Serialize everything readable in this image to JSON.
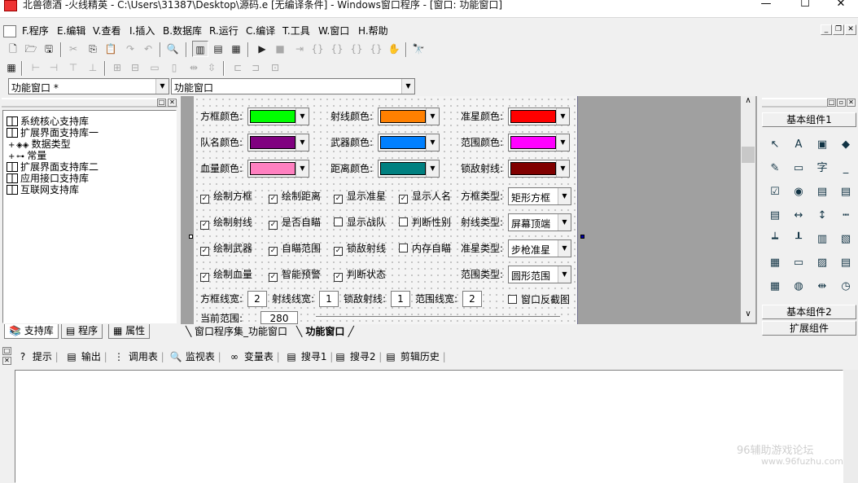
{
  "window": {
    "title": "北兽德酒 -火线精英 - C:\\Users\\31387\\Desktop\\源码.e [无编译条件] - Windows窗口程序 - [窗口: 功能窗口]",
    "min": "—",
    "max": "☐",
    "close": "✕"
  },
  "menu": [
    "F.程序",
    "E.编辑",
    "V.查看",
    "I.插入",
    "B.数据库",
    "R.运行",
    "C.编译",
    "T.工具",
    "W.窗口",
    "H.帮助"
  ],
  "mdi_buttons": [
    "_",
    "❐",
    "✕"
  ],
  "combos": {
    "left": "功能窗口 *",
    "right": "功能窗口"
  },
  "left_panel": {
    "tree": [
      {
        "label": "系统核心支持库",
        "level": 0
      },
      {
        "label": "扩展界面支持库一",
        "level": 0
      },
      {
        "label": "数据类型",
        "level": 1,
        "expander": "+"
      },
      {
        "label": "常量",
        "level": 1,
        "expander": "+"
      },
      {
        "label": "扩展界面支持库二",
        "level": 0
      },
      {
        "label": "应用接口支持库",
        "level": 0
      },
      {
        "label": "互联网支持库",
        "level": 0
      }
    ],
    "tabs": [
      "支持库",
      "程序",
      "属性"
    ]
  },
  "form": {
    "colors": [
      {
        "label": "方框颜色:",
        "color": "#00ff00"
      },
      {
        "label": "射线颜色:",
        "color": "#ff8000"
      },
      {
        "label": "准星颜色:",
        "color": "#ff0000"
      },
      {
        "label": "队名颜色:",
        "color": "#800080"
      },
      {
        "label": "武器颜色:",
        "color": "#0080ff"
      },
      {
        "label": "范围颜色:",
        "color": "#ff00ff"
      },
      {
        "label": "血量颜色:",
        "color": "#ff80c0"
      },
      {
        "label": "距离颜色:",
        "color": "#008080"
      },
      {
        "label": "锁敌射线:",
        "color": "#800000"
      }
    ],
    "checks": [
      [
        "绘制方框",
        "绘制距离",
        "显示准星",
        "显示人名"
      ],
      [
        "绘制射线",
        "是否自瞄",
        "显示战队",
        "判断性别"
      ],
      [
        "绘制武器",
        "自瞄范围",
        "锁敌射线",
        "内存自瞄"
      ],
      [
        "绘制血量",
        "智能预警",
        "判断状态"
      ]
    ],
    "checked": [
      [
        true,
        true,
        true,
        true
      ],
      [
        true,
        true,
        false,
        false
      ],
      [
        true,
        true,
        true,
        false
      ],
      [
        true,
        true,
        true
      ]
    ],
    "selects": [
      {
        "label": "方框类型:",
        "value": "矩形方框"
      },
      {
        "label": "射线类型:",
        "value": "屏幕顶端"
      },
      {
        "label": "准星类型:",
        "value": "步枪准星"
      },
      {
        "label": "范围类型:",
        "value": "圆形范围"
      }
    ],
    "widths": [
      {
        "label": "方框线宽:",
        "value": "2"
      },
      {
        "label": "射线线宽:",
        "value": "1"
      },
      {
        "label": "锁敌射线:",
        "value": "1"
      },
      {
        "label": "范围线宽:",
        "value": "2"
      }
    ],
    "flip_check": "窗口反截图",
    "partial_label": "当前范围:",
    "partial_value": "280"
  },
  "editor_tabs": [
    "窗口程序集_功能窗口",
    "功能窗口"
  ],
  "right_panel": {
    "group_top": "基本组件1",
    "group_mid": "基本组件2",
    "group_bot": "扩展组件"
  },
  "bottom_tabs": [
    {
      "label": "提示",
      "icon": "?"
    },
    {
      "label": "输出",
      "icon": "▤"
    },
    {
      "label": "调用表",
      "icon": "⋮"
    },
    {
      "label": "监视表",
      "icon": "🔍"
    },
    {
      "label": "变量表",
      "icon": "∞"
    },
    {
      "label": "搜寻1",
      "icon": "▤"
    },
    {
      "label": "搜寻2",
      "icon": "▤"
    },
    {
      "label": "剪辑历史",
      "icon": "▤"
    }
  ],
  "watermark": {
    "line1": "96辅助游戏论坛",
    "line2": "www.96fuzhu.com"
  }
}
